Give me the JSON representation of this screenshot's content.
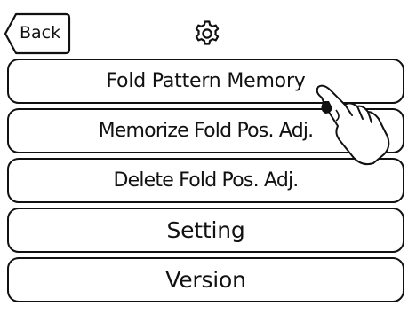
{
  "header": {
    "back_label": "Back",
    "settings_icon": "gear-icon"
  },
  "menu": {
    "items": [
      {
        "label": "Fold Pattern Memory"
      },
      {
        "label": "Memorize Fold Pos. Adj."
      },
      {
        "label": "Delete Fold Pos. Adj."
      },
      {
        "label": "Setting"
      },
      {
        "label": "Version"
      }
    ]
  },
  "overlay": {
    "pointer_icon": "pointing-hand-icon"
  }
}
